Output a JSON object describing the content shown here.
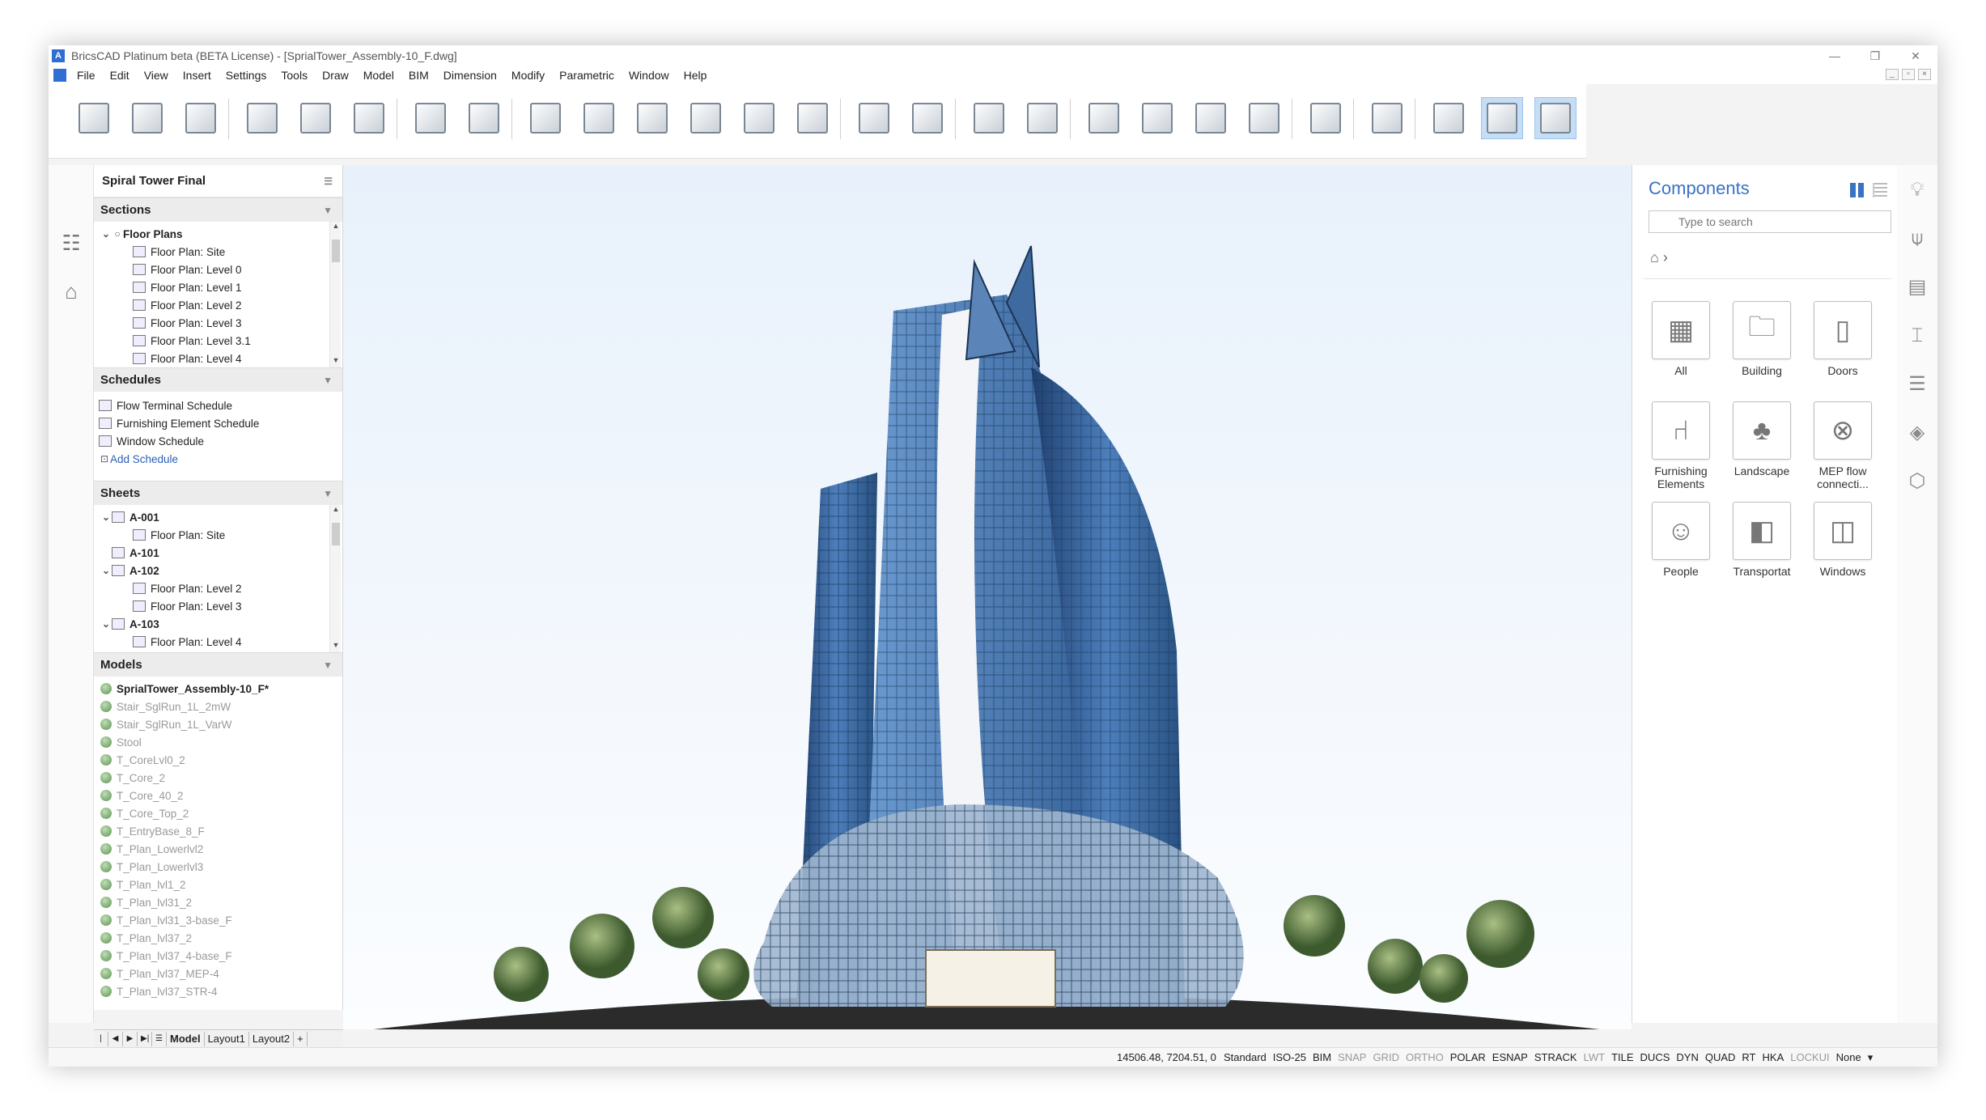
{
  "window": {
    "title": "BricsCAD Platinum beta (BETA License) - [SprialTower_Assembly-10_F.dwg]",
    "controls": [
      "—",
      "❐",
      "✕"
    ],
    "app_icon": "bricscad-logo-icon"
  },
  "menu": [
    "File",
    "Edit",
    "View",
    "Insert",
    "Settings",
    "Tools",
    "Draw",
    "Model",
    "BIM",
    "Dimension",
    "Modify",
    "Parametric",
    "Window",
    "Help"
  ],
  "toolbar": {
    "icons": [
      "3d-box-stack-icon",
      "wall-icon",
      "solid-box-icon",
      "line-icon",
      "rectangle-icon",
      "circle-icon",
      "extrude-icon",
      "profile-icon",
      "lock-classify-icon",
      "house-icon",
      "building-blocks-icon",
      "spatial-locations-icon",
      "stair-icon",
      "window-icon",
      "grid-icon",
      "slab-layers-icon",
      "beam-icon",
      "roof-icon",
      "structure-icon",
      "stacked-boxes-icon",
      "refresh-icon",
      "dimension-text-icon",
      "hatch-icon",
      "cloud-export-icon",
      "view-cube-icon",
      "view-cube-shaded-icon",
      "wireframe-view-icon"
    ],
    "active": [
      25,
      26
    ]
  },
  "left_strip": [
    "structure-tree-icon",
    "home-icon"
  ],
  "browser": {
    "title": "Spiral Tower Final",
    "sections": {
      "sections_label": "Sections",
      "floor_plans_label": "Floor Plans",
      "floor_plans": [
        "Floor Plan: Site",
        "Floor Plan: Level 0",
        "Floor Plan: Level 1",
        "Floor Plan: Level 2",
        "Floor Plan: Level 3",
        "Floor Plan: Level 3.1",
        "Floor Plan: Level 4"
      ]
    },
    "schedules": {
      "label": "Schedules",
      "items": [
        "Flow Terminal Schedule",
        "Furnishing Element Schedule",
        "Window Schedule"
      ],
      "add": "Add Schedule"
    },
    "sheets": {
      "label": "Sheets",
      "items": [
        {
          "name": "A-001",
          "children": [
            "Floor Plan: Site"
          ]
        },
        {
          "name": "A-101",
          "children": []
        },
        {
          "name": "A-102",
          "children": [
            "Floor Plan: Level 2",
            "Floor Plan: Level 3"
          ]
        },
        {
          "name": "A-103",
          "children": [
            "Floor Plan: Level 4"
          ]
        }
      ]
    },
    "models": {
      "label": "Models",
      "current": "SprialTower_Assembly-10_F*",
      "items": [
        "Stair_SglRun_1L_2mW",
        "Stair_SglRun_1L_VarW",
        "Stool",
        "T_CoreLvl0_2",
        "T_Core_2",
        "T_Core_40_2",
        "T_Core_Top_2",
        "T_EntryBase_8_F",
        "T_Plan_Lowerlvl2",
        "T_Plan_Lowerlvl3",
        "T_Plan_lvl1_2",
        "T_Plan_lvl31_2",
        "T_Plan_lvl31_3-base_F",
        "T_Plan_lvl37_2",
        "T_Plan_lvl37_4-base_F",
        "T_Plan_lvl37_MEP-4",
        "T_Plan_lvl37_STR-4"
      ]
    }
  },
  "layout_tabs": [
    "Model",
    "Layout1",
    "Layout2",
    "+"
  ],
  "components": {
    "title": "Components",
    "search_placeholder": "Type to search",
    "breadcrumb": "⌂ ›",
    "tiles": [
      {
        "label": "All",
        "icon": "grid-icon"
      },
      {
        "label": "Building",
        "icon": "folder-icon"
      },
      {
        "label": "Doors",
        "icon": "door-icon"
      },
      {
        "label": "Furnishing Elements",
        "icon": "chair-icon"
      },
      {
        "label": "Landscape",
        "icon": "tree-icon"
      },
      {
        "label": "MEP flow connecti...",
        "icon": "circle-cross-icon"
      },
      {
        "label": "People",
        "icon": "people-icon"
      },
      {
        "label": "Transportat",
        "icon": "vehicle-icon"
      },
      {
        "label": "Windows",
        "icon": "window-frame-icon"
      }
    ]
  },
  "right_strip": [
    "lightbulb-icon",
    "hot-air-balloon-icon",
    "wall-layers-icon",
    "i-beam-icon",
    "sliders-icon",
    "layers-icon",
    "cube-library-icon"
  ],
  "status": {
    "coords": "14506.48, 7204.51, 0",
    "items": [
      {
        "t": "Standard",
        "on": true
      },
      {
        "t": "ISO-25",
        "on": true
      },
      {
        "t": "BIM",
        "on": true
      },
      {
        "t": "SNAP",
        "on": false
      },
      {
        "t": "GRID",
        "on": false
      },
      {
        "t": "ORTHO",
        "on": false
      },
      {
        "t": "POLAR",
        "on": true
      },
      {
        "t": "ESNAP",
        "on": true
      },
      {
        "t": "STRACK",
        "on": true
      },
      {
        "t": "LWT",
        "on": false
      },
      {
        "t": "TILE",
        "on": true
      },
      {
        "t": "DUCS",
        "on": true
      },
      {
        "t": "DYN",
        "on": true
      },
      {
        "t": "QUAD",
        "on": true
      },
      {
        "t": "RT",
        "on": true
      },
      {
        "t": "HKA",
        "on": true
      },
      {
        "t": "LOCKUI",
        "on": false
      },
      {
        "t": "None",
        "on": true
      }
    ]
  },
  "colors": {
    "accent": "#3a72c4",
    "sky": "#eef5fc",
    "glass": "#2e5f99"
  }
}
